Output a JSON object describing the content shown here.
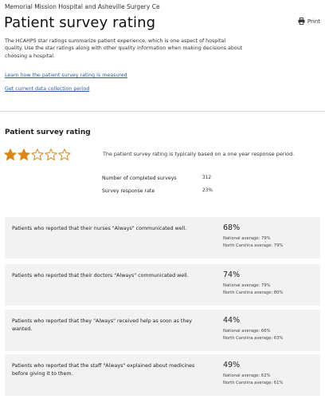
{
  "header": {
    "hospital_name": "Memorial Mission Hospital and Asheville Surgery Ce",
    "title": "Patient survey rating",
    "print_label": "Print",
    "intro": "The HCAHPS star ratings summarize patient experience, which is one aspect of hospital quality. Use the star ratings along with other quality information when making decisions about choosing a hospital."
  },
  "links": {
    "how_measured": "Learn how the patient survey rating is measured",
    "collection_period": "Get current data collection period"
  },
  "rating": {
    "section_title": "Patient survey rating",
    "stars_filled": 2,
    "stars_total": 5,
    "star_color": "#d9871a",
    "note": "The patient survey rating is typically based on a one year response period.",
    "completed_label": "Number of completed surveys",
    "completed_value": "312",
    "response_label": "Survey response rate",
    "response_value": "23%"
  },
  "measures": [
    {
      "question": "Patients who reported that their nurses \"Always\" communicated well.",
      "percent": "68%",
      "national": "National average: 79%",
      "state": "North Carolina average: 79%"
    },
    {
      "question": "Patients who reported that their doctors \"Always\" communicated well.",
      "percent": "74%",
      "national": "National average: 79%",
      "state": "North Carolina average: 80%"
    },
    {
      "question": "Patients who reported that they \"Always\" received help as soon as they wanted.",
      "percent": "44%",
      "national": "National average: 66%",
      "state": "North Carolina average: 63%"
    },
    {
      "question": "Patients who reported that the staff \"Always\" explained about medicines before giving it to them.",
      "percent": "49%",
      "national": "National average: 62%",
      "state": "North Carolina average: 61%"
    }
  ]
}
